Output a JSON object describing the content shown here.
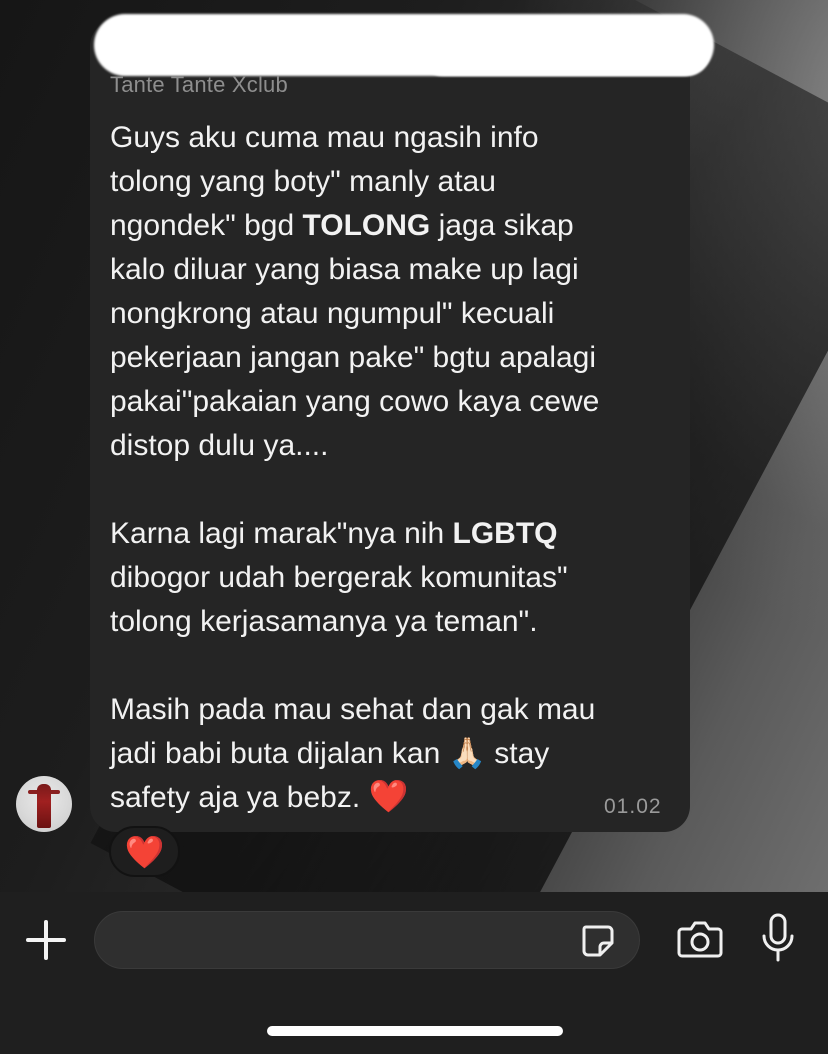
{
  "chat": {
    "sender": "Tante Tante Xclub",
    "message": {
      "paragraph1_line1": "Guys aku cuma mau ngasih info",
      "paragraph1_line2": "tolong yang boty\" manly atau",
      "paragraph1_line3a": "ngondek\" bgd ",
      "paragraph1_line3_bold": "TOLONG",
      "paragraph1_line3b": " jaga sikap",
      "paragraph1_line4": "kalo diluar yang biasa make up lagi",
      "paragraph1_line5": "nongkrong atau ngumpul\" kecuali",
      "paragraph1_line6": "pekerjaan jangan pake\" bgtu apalagi",
      "paragraph1_line7": "pakai\"pakaian yang cowo kaya cewe",
      "paragraph1_line8": "distop dulu ya....",
      "paragraph2_line1a": "Karna lagi marak\"nya nih ",
      "paragraph2_line1_bold": "LGBTQ",
      "paragraph2_line2": "dibogor udah bergerak komunitas\"",
      "paragraph2_line3": "tolong kerjasamanya ya teman\".",
      "paragraph3_line1": "Masih pada mau sehat dan gak mau",
      "paragraph3_line2a": "jadi babi buta dijalan kan ",
      "paragraph3_line2_emoji": "🙏🏻",
      "paragraph3_line2b": " stay",
      "paragraph3_line3": "safety aja ya bebz. ",
      "paragraph3_line3_emoji": "❤️"
    },
    "time": "01.02",
    "reaction": "❤️",
    "avatar_icon": "profile-avatar"
  },
  "composer": {
    "input_value": "",
    "icons": {
      "attach": "plus-icon",
      "sticker": "sticker-icon",
      "camera": "camera-icon",
      "voice": "microphone-icon"
    }
  },
  "colors": {
    "bubble": "#252525",
    "text": "#f2f2f2",
    "sender": "#8e8e8e",
    "heart": "#e11d2a",
    "input_bar": "#1f1f1f"
  }
}
